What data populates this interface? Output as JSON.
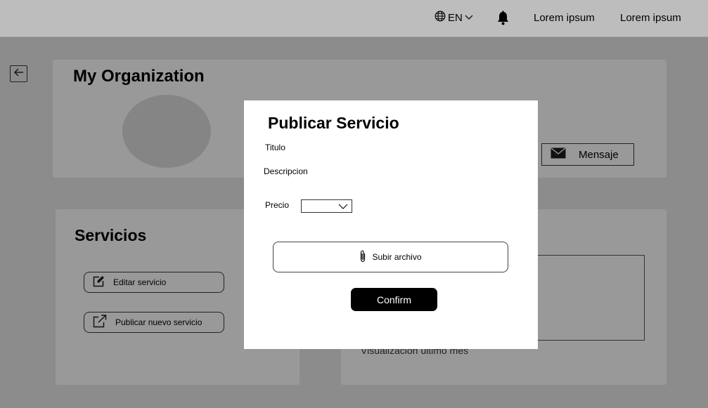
{
  "topbar": {
    "language": "EN",
    "link1": "Lorem ipsum",
    "link2": "Lorem ipsum"
  },
  "organization": {
    "title": "My Organization",
    "message_button": "Mensaje"
  },
  "services": {
    "title": "Servicios",
    "edit_label": "Editar servicio",
    "publish_label": "Publicar nuevo servicio"
  },
  "stats": {
    "caption": "Visualización último mes"
  },
  "modal": {
    "title": "Publicar Servicio",
    "title_label": "Titulo",
    "description_label": "Descripcion",
    "price_label": "Precio",
    "upload_label": "Subir archivo",
    "confirm_label": "Confirm"
  },
  "icons": {
    "language": "globe-icon",
    "notifications": "bell-icon",
    "back": "arrow-left-icon",
    "message": "envelope-icon",
    "edit": "edit-icon",
    "publish": "external-link-icon",
    "upload": "paperclip-icon",
    "dropdown": "chevron-down-icon"
  },
  "colors": {
    "overlay": "#8c8c8c",
    "topbar": "#bdbdbd",
    "card": "#999999",
    "modal": "#ffffff",
    "confirm_button": "#000000"
  }
}
